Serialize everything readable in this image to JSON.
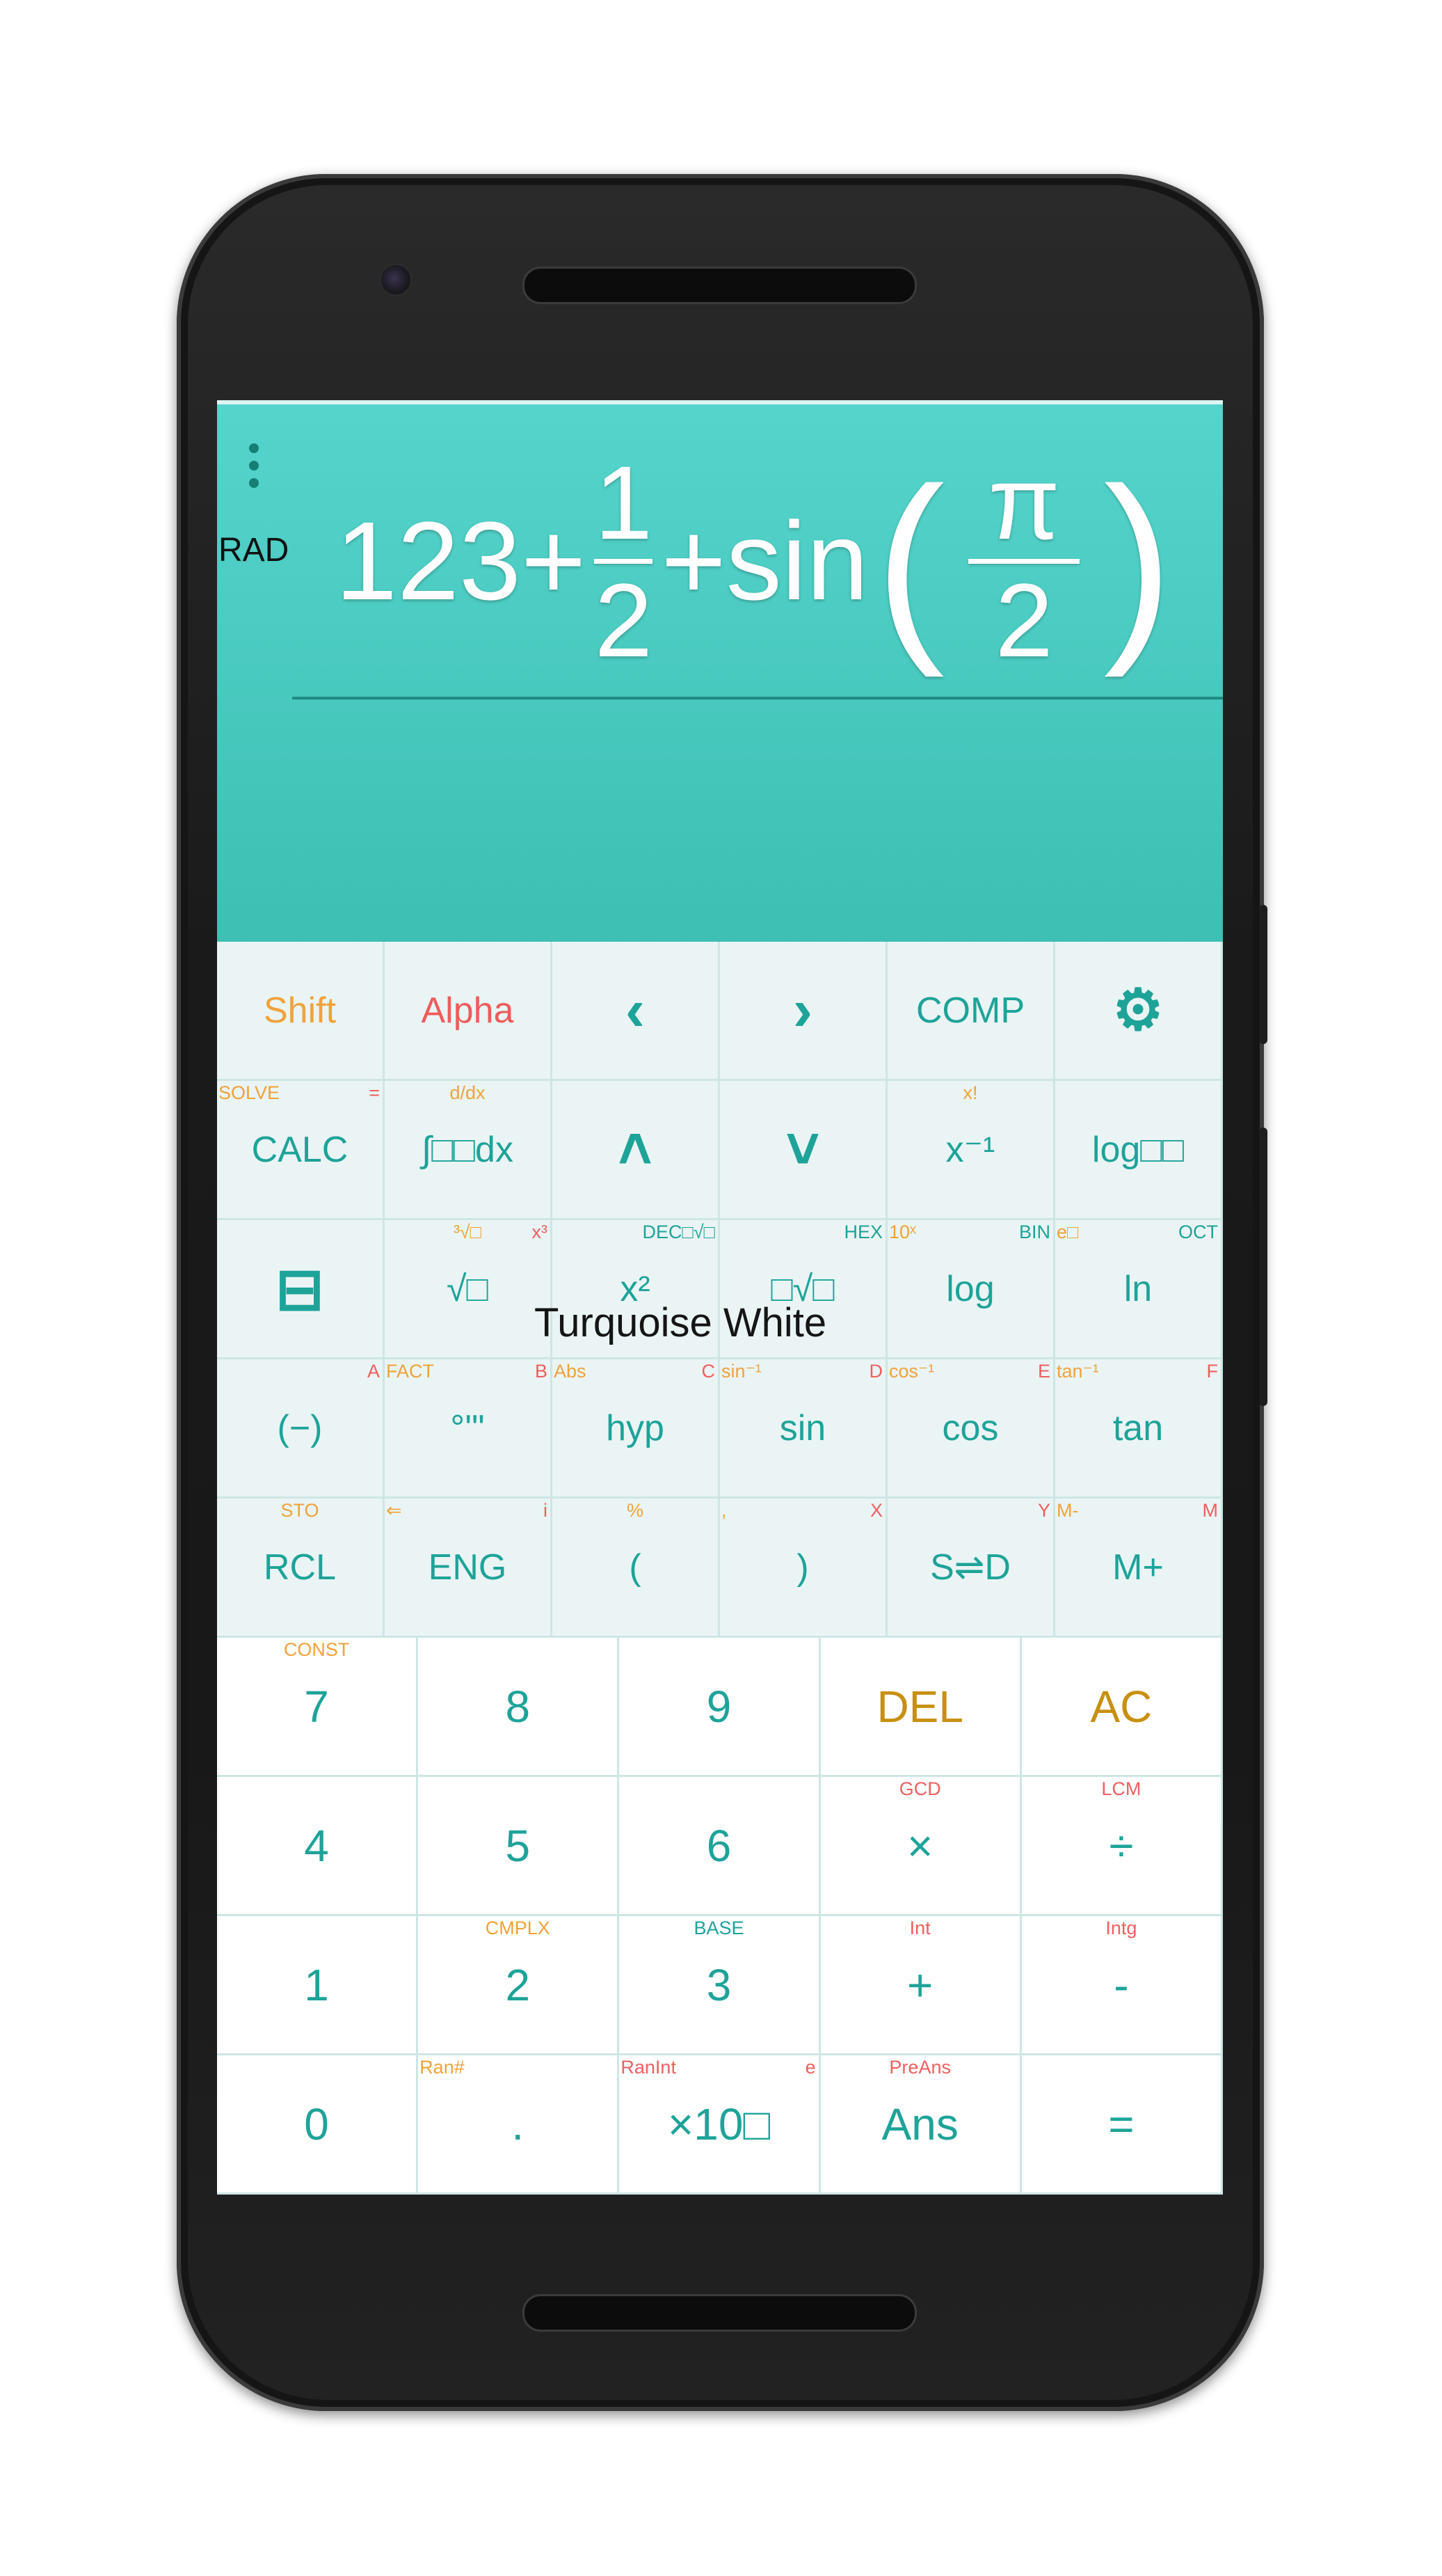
{
  "display": {
    "mode": "RAD",
    "expression": {
      "lead": "123+",
      "frac1_num": "1",
      "frac1_den": "2",
      "mid": "+sin",
      "paren_open": "(",
      "frac2_num": "π",
      "frac2_den": "2",
      "paren_close": ")"
    }
  },
  "keypad_top": [
    {
      "label": "Shift",
      "color": "orange"
    },
    {
      "label": "Alpha",
      "color": "red"
    },
    {
      "icon": "chevron-left-icon",
      "glyph": "‹"
    },
    {
      "icon": "chevron-right-icon",
      "glyph": "›"
    },
    {
      "label": "COMP"
    },
    {
      "icon": "gear-icon",
      "glyph": "⚙"
    },
    {
      "label": "CALC",
      "sub_left": "SOLVE",
      "sub_left_color": "orange",
      "sub_right": "=",
      "sub_right_color": "red"
    },
    {
      "label": "∫□□dx",
      "sub_center": "d/dx",
      "sub_center_color": "orange"
    },
    {
      "icon": "chevron-up-icon",
      "glyph": "˄"
    },
    {
      "icon": "chevron-down-icon",
      "glyph": "˅"
    },
    {
      "label": "x⁻¹",
      "sub_center": "x!",
      "sub_center_color": "orange"
    },
    {
      "label": "log□□"
    },
    {
      "icon": "fraction-icon",
      "glyph": "⊟"
    },
    {
      "label": "√□",
      "sub_center": "³√□",
      "sub_center_color": "orange",
      "sub_right": "x³",
      "sub_right_color": "red"
    },
    {
      "label": "x²",
      "sub_left": "",
      "sub_right": "DEC□√□",
      "sub_right_color": "teal"
    },
    {
      "label": "□√□",
      "sub_right": "HEX",
      "sub_right_color": "teal"
    },
    {
      "label": "log",
      "sub_left": "10ˣ",
      "sub_left_color": "orange",
      "sub_right": "BIN",
      "sub_right_color": "teal"
    },
    {
      "label": "ln",
      "sub_left": "e□",
      "sub_left_color": "orange",
      "sub_right": "OCT",
      "sub_right_color": "teal"
    },
    {
      "label": "(−)",
      "sub_right": "A",
      "sub_right_color": "red"
    },
    {
      "label": "°'\"",
      "sub_left": "FACT",
      "sub_left_color": "orange",
      "sub_right": "B",
      "sub_right_color": "red"
    },
    {
      "label": "hyp",
      "sub_left": "Abs",
      "sub_left_color": "orange",
      "sub_right": "C",
      "sub_right_color": "red"
    },
    {
      "label": "sin",
      "sub_left": "sin⁻¹",
      "sub_left_color": "orange",
      "sub_right": "D",
      "sub_right_color": "red"
    },
    {
      "label": "cos",
      "sub_left": "cos⁻¹",
      "sub_left_color": "orange",
      "sub_right": "E",
      "sub_right_color": "red"
    },
    {
      "label": "tan",
      "sub_left": "tan⁻¹",
      "sub_left_color": "orange",
      "sub_right": "F",
      "sub_right_color": "red"
    },
    {
      "label": "RCL",
      "sub_center": "STO",
      "sub_center_color": "orange"
    },
    {
      "label": "ENG",
      "sub_left": "⇐",
      "sub_left_color": "orange",
      "sub_right": "i",
      "sub_right_color": "red"
    },
    {
      "label": "(",
      "sub_center": "%",
      "sub_center_color": "orange"
    },
    {
      "label": ")",
      "sub_left": ",",
      "sub_left_color": "orange",
      "sub_right": "X",
      "sub_right_color": "red"
    },
    {
      "label": "S⇌D",
      "sub_right": "Y",
      "sub_right_color": "red"
    },
    {
      "label": "M+",
      "sub_left": "M-",
      "sub_left_color": "orange",
      "sub_right": "M",
      "sub_right_color": "red"
    }
  ],
  "keypad_bottom": [
    {
      "label": "7",
      "sub_center": "CONST",
      "sub_center_color": "orange"
    },
    {
      "label": "8"
    },
    {
      "label": "9"
    },
    {
      "label": "DEL",
      "color": "gold"
    },
    {
      "label": "AC",
      "color": "gold"
    },
    {
      "label": "4"
    },
    {
      "label": "5"
    },
    {
      "label": "6"
    },
    {
      "label": "×",
      "sub_center": "GCD",
      "sub_center_color": "red"
    },
    {
      "label": "÷",
      "sub_center": "LCM",
      "sub_center_color": "red"
    },
    {
      "label": "1"
    },
    {
      "label": "2",
      "sub_center": "CMPLX",
      "sub_center_color": "orange"
    },
    {
      "label": "3",
      "sub_center": "BASE",
      "sub_center_color": "teal"
    },
    {
      "label": "+",
      "sub_center": "Int",
      "sub_center_color": "red"
    },
    {
      "label": "-",
      "sub_center": "Intg",
      "sub_center_color": "red"
    },
    {
      "label": "0"
    },
    {
      "label": ".",
      "sub_left": "Ran#",
      "sub_left_color": "orange"
    },
    {
      "label": "×10□",
      "sub_left": "RanInt",
      "sub_left_color": "red",
      "sub_right": "e",
      "sub_right_color": "red"
    },
    {
      "label": "Ans",
      "sub_center": "PreAns",
      "sub_center_color": "red"
    },
    {
      "label": "="
    }
  ],
  "theme_name": "Turquoise White",
  "colors": {
    "display_top": "#55d4cb",
    "display_bottom": "#3dbfb3",
    "key_teal": "#1ea399",
    "accent_orange": "#f0a23a",
    "accent_red": "#ee5c5c",
    "accent_gold": "#c89010"
  }
}
